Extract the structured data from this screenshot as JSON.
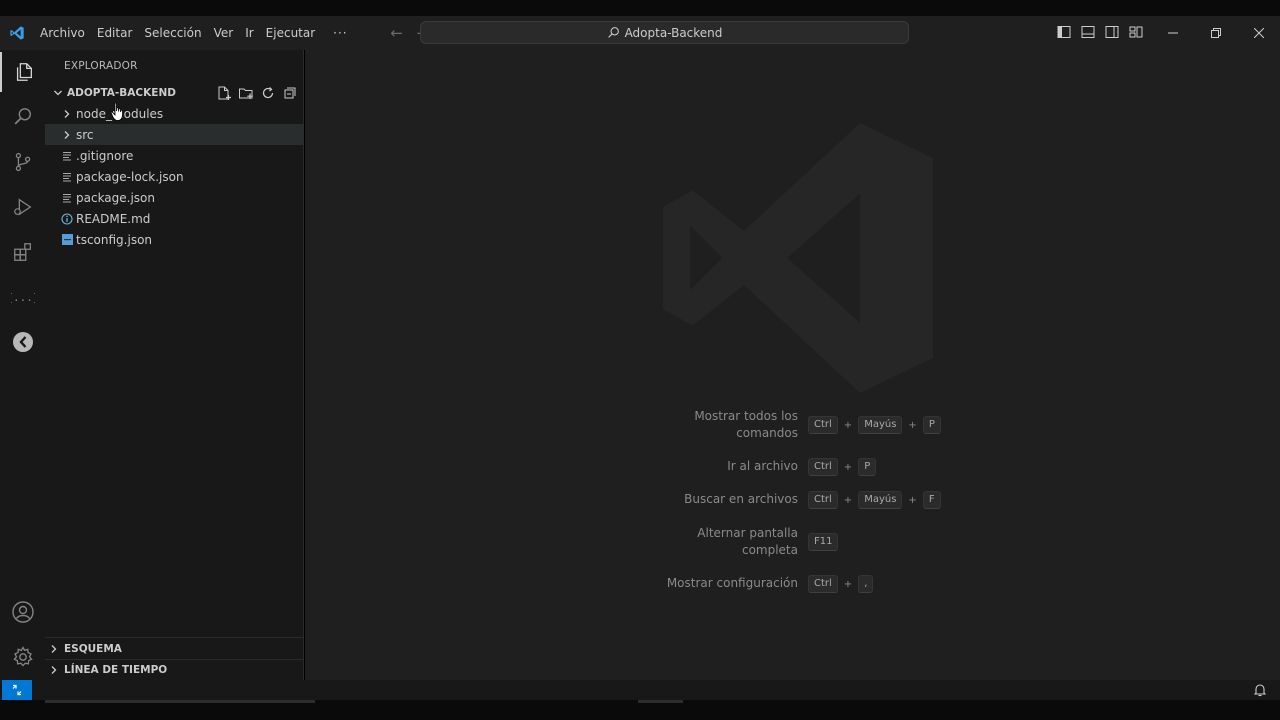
{
  "menu": [
    "Archivo",
    "Editar",
    "Selección",
    "Ver",
    "Ir",
    "Ejecutar"
  ],
  "menu_more": "···",
  "search_text": "Adopta-Backend",
  "sidebar": {
    "title": "EXPLORADOR",
    "folder": "ADOPTA-BACKEND",
    "items": [
      {
        "label": "node_modules",
        "kind": "folder"
      },
      {
        "label": "src",
        "kind": "folder"
      },
      {
        "label": ".gitignore",
        "kind": "file"
      },
      {
        "label": "package-lock.json",
        "kind": "json"
      },
      {
        "label": "package.json",
        "kind": "json"
      },
      {
        "label": "README.md",
        "kind": "info"
      },
      {
        "label": "tsconfig.json",
        "kind": "ts"
      }
    ],
    "sections": [
      "ESQUEMA",
      "LÍNEA DE TIEMPO"
    ]
  },
  "shortcuts": [
    {
      "label": "Mostrar todos los comandos",
      "keys": [
        "Ctrl",
        "Mayús",
        "P"
      ]
    },
    {
      "label": "Ir al archivo",
      "keys": [
        "Ctrl",
        "P"
      ]
    },
    {
      "label": "Buscar en archivos",
      "keys": [
        "Ctrl",
        "Mayús",
        "F"
      ]
    },
    {
      "label": "Alternar pantalla completa",
      "keys": [
        "F11"
      ]
    },
    {
      "label": "Mostrar configuración",
      "keys": [
        "Ctrl",
        ","
      ]
    }
  ],
  "colors": {
    "accent": "#0078d4",
    "background": "#1f1f1f",
    "sidebar": "#181818"
  }
}
